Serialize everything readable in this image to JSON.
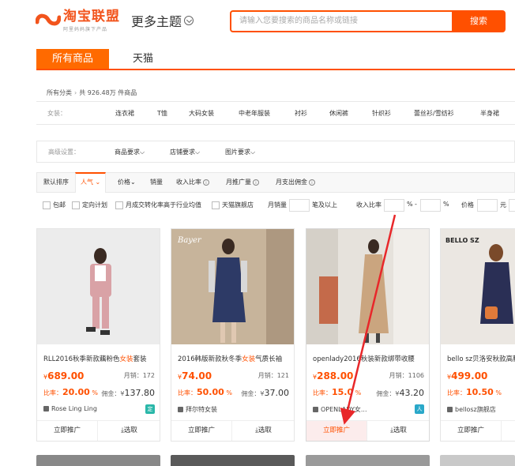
{
  "header": {
    "logo_title": "淘宝联盟",
    "logo_sub": "阿里妈妈旗下产品",
    "more_topics": "更多主题",
    "search_placeholder": "请输入您要搜索的商品名称或链接",
    "search_button": "搜索"
  },
  "tabs": [
    {
      "label": "所有商品",
      "active": true
    },
    {
      "label": "天猫",
      "active": false
    }
  ],
  "breadcrumb": {
    "all": "所有分类",
    "count": "共 926.48万 件商品"
  },
  "category_row": {
    "label": "女装：",
    "items": [
      "连衣裙",
      "T恤",
      "大码女装",
      "中老年服装",
      "衬衫",
      "休闲裤",
      "针织衫",
      "蕾丝衫/雪纺衫",
      "半身裙"
    ]
  },
  "advanced": {
    "label": "高级设置：",
    "items": [
      "商品要求",
      "店铺要求",
      "图片要求"
    ]
  },
  "sort": {
    "items": [
      "默认排序",
      "人气",
      "价格",
      "销量",
      "收入比率",
      "月推广量",
      "月支出佣金"
    ]
  },
  "filters": {
    "items": [
      "包邮",
      "定向计划",
      "月成交转化率高于行业均值",
      "天猫旗舰店"
    ],
    "monthly_sales_label": "月销量",
    "monthly_sales_suffix": "笔及以上",
    "ratio_label": "收入比率",
    "percent": "%",
    "dash": "-",
    "price_label": "价格",
    "currency": "元"
  },
  "products": [
    {
      "title_pre": "RLL2016秋季新款藕粉色",
      "title_hl": "女装",
      "title_post": "套装",
      "price_symbol": "¥",
      "price": "689.00",
      "sales": "月销：172",
      "ratio_label": "比率：",
      "ratio": "20.00",
      "ratio_unit": " %",
      "comm_label": "佣金：¥",
      "comm": "137.80",
      "shop": "Rose Ling Ling",
      "badge": "定"
    },
    {
      "title_pre": "2016韩版新款秋冬季",
      "title_hl": "女装",
      "title_post": "气质长袖",
      "price_symbol": "¥",
      "price": "74.00",
      "sales": "月销：121",
      "ratio_label": "比率：",
      "ratio": "50.00",
      "ratio_unit": " %",
      "comm_label": "佣金：¥",
      "comm": "37.00",
      "shop": "拜尔特女装",
      "badge": ""
    },
    {
      "title_pre": "openlady2016秋装新款",
      "title_hl": "",
      "title_post": "绑带收腰",
      "price_symbol": "¥",
      "price": "288.00",
      "sales": "月销：1106",
      "ratio_label": "比率：",
      "ratio": "15.0",
      "ratio_unit": " %",
      "comm_label": "佣金：¥",
      "comm": "43.20",
      "shop": "OPENLADY女...",
      "badge": "人"
    },
    {
      "title_pre": "bello sz贝洛安秋款高腰",
      "title_hl": "",
      "title_post": "",
      "price_symbol": "¥",
      "price": "499.00",
      "sales": "",
      "ratio_label": "比率：",
      "ratio": "10.50",
      "ratio_unit": " %",
      "comm_label": "",
      "comm": "",
      "shop": "bellosz旗舰店",
      "badge": ""
    }
  ],
  "card_actions": {
    "promote": "立即推广",
    "select": "选取"
  },
  "image_text": {
    "bayer": "Bayer",
    "bello": "BELLO SZ"
  },
  "colors": {
    "brand": "#ff5000",
    "tab_active": "#ff6a00",
    "annotation_arrow": "#e8272a"
  }
}
